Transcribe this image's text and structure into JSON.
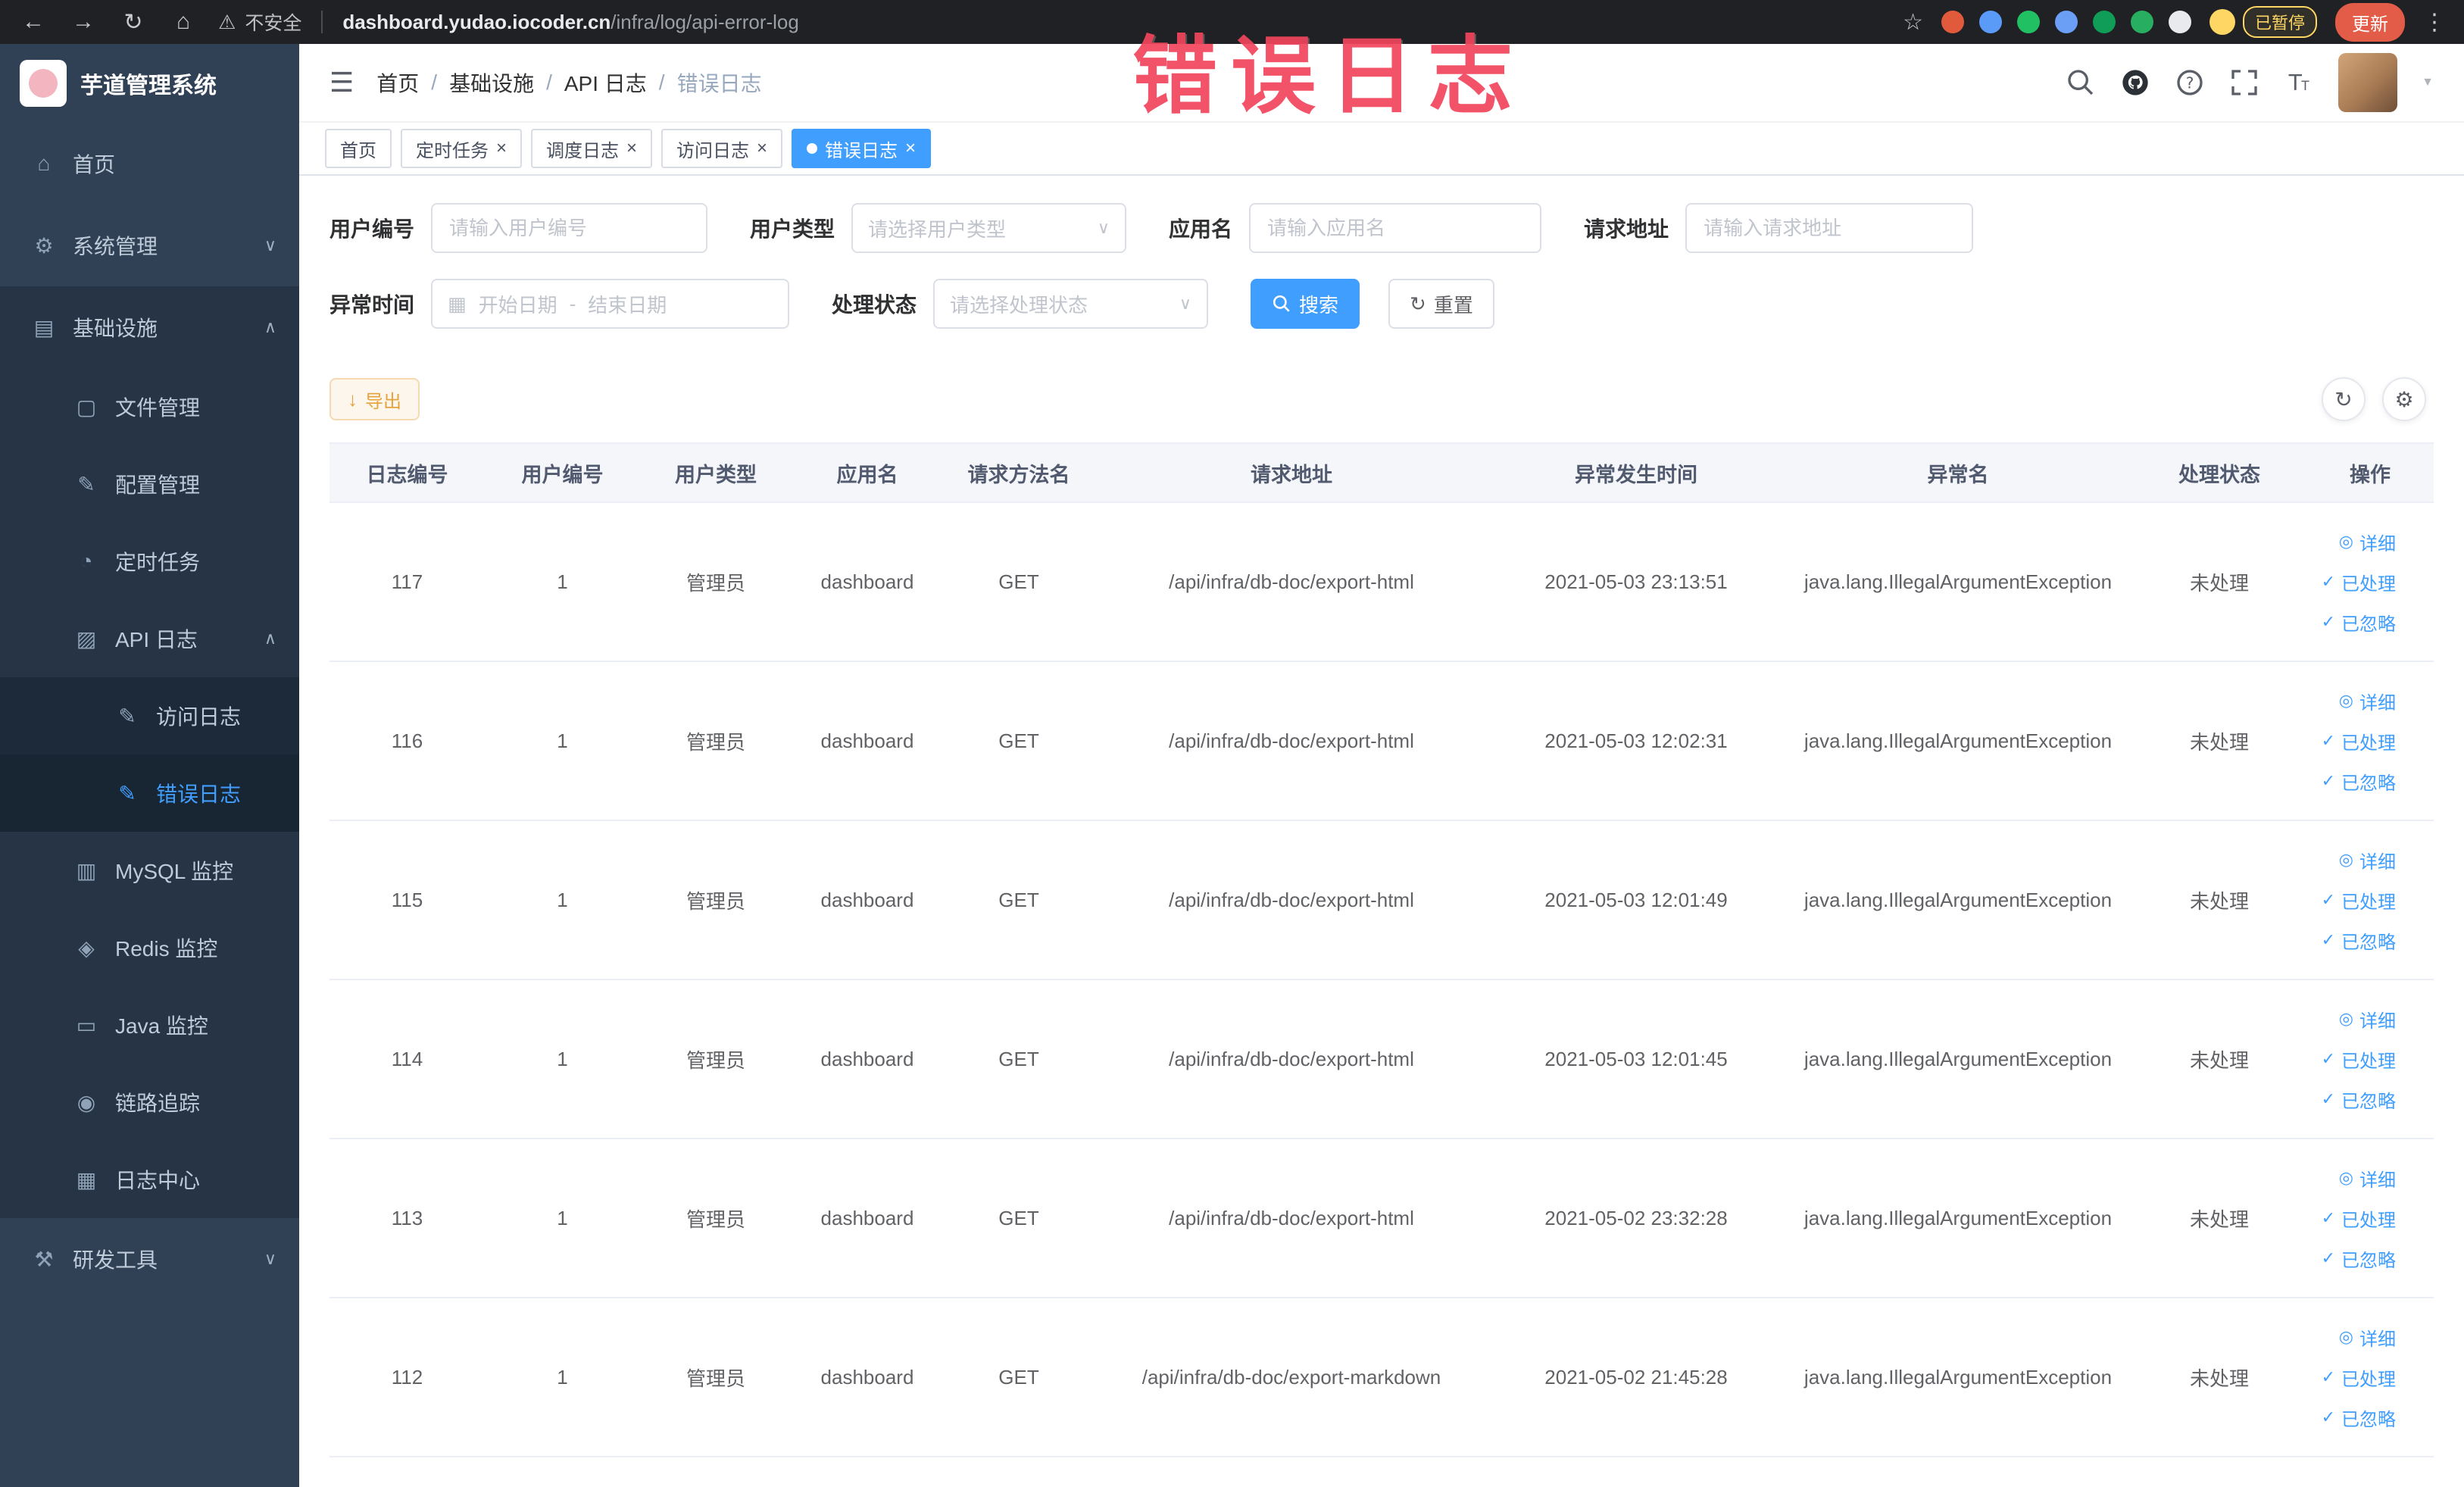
{
  "colors": {
    "primary": "#409eff",
    "warning": "#e6a23c",
    "sidebar_bg": "#304156",
    "chrome_bg": "#202124",
    "annotation_red": "#f2455c"
  },
  "annotation": {
    "text": "错误日志"
  },
  "browser": {
    "security_label": "不安全",
    "url_domain": "dashboard.yudao.iocoder.cn",
    "url_path": "/infra/log/api-error-log",
    "profile_badge": "已暂停",
    "update_label": "更新",
    "extensions": [
      {
        "name": "extension-red-circle-icon",
        "color": "#e25a3c"
      },
      {
        "name": "extension-blue-drop-icon",
        "color": "#5b9bf8"
      },
      {
        "name": "extension-green-circle-icon",
        "color": "#21c063"
      },
      {
        "name": "extension-blue-grid-icon",
        "color": "#6b9ef5"
      },
      {
        "name": "extension-on-badge-icon",
        "color": "#0f9d58"
      },
      {
        "name": "extension-leaf-icon",
        "color": "#27ae60"
      },
      {
        "name": "extension-paw-icon",
        "color": "#e8eaed"
      }
    ]
  },
  "sidebar": {
    "title": "芋道管理系统",
    "items": [
      {
        "id": "home",
        "label": "首页",
        "level": 1,
        "icon": "home-icon"
      },
      {
        "id": "system",
        "label": "系统管理",
        "level": 1,
        "icon": "gear-icon",
        "chevron": "down"
      },
      {
        "id": "infra",
        "label": "基础设施",
        "level": 1,
        "icon": "grid-icon",
        "chevron": "up",
        "open": true
      },
      {
        "id": "file",
        "label": "文件管理",
        "level": 2,
        "icon": "folder-icon"
      },
      {
        "id": "config",
        "label": "配置管理",
        "level": 2,
        "icon": "edit-square-icon"
      },
      {
        "id": "job",
        "label": "定时任务",
        "level": 2,
        "icon": "clock-icon"
      },
      {
        "id": "api-log",
        "label": "API 日志",
        "level": 2,
        "icon": "doc-edit-icon",
        "chevron": "up",
        "open": true
      },
      {
        "id": "access-log",
        "label": "访问日志",
        "level": 3,
        "icon": "edit-square-icon"
      },
      {
        "id": "error-log",
        "label": "错误日志",
        "level": 3,
        "icon": "edit-square-icon",
        "active": true
      },
      {
        "id": "mysql",
        "label": "MySQL 监控",
        "level": 2,
        "icon": "database-icon"
      },
      {
        "id": "redis",
        "label": "Redis 监控",
        "level": 2,
        "icon": "redis-icon"
      },
      {
        "id": "java",
        "label": "Java 监控",
        "level": 2,
        "icon": "monitor-icon"
      },
      {
        "id": "trace",
        "label": "链路追踪",
        "level": 2,
        "icon": "eye-icon"
      },
      {
        "id": "log-center",
        "label": "日志中心",
        "level": 2,
        "icon": "log-center-icon"
      },
      {
        "id": "dev-tools",
        "label": "研发工具",
        "level": 1,
        "icon": "tools-icon",
        "chevron": "down"
      }
    ]
  },
  "header": {
    "breadcrumb": [
      "首页",
      "基础设施",
      "API 日志",
      "错误日志"
    ]
  },
  "tabs": [
    {
      "id": "home",
      "label": "首页",
      "closable": false,
      "active": false
    },
    {
      "id": "job",
      "label": "定时任务",
      "closable": true,
      "active": false
    },
    {
      "id": "job-log",
      "label": "调度日志",
      "closable": true,
      "active": false
    },
    {
      "id": "access-log",
      "label": "访问日志",
      "closable": true,
      "active": false
    },
    {
      "id": "error-log",
      "label": "错误日志",
      "closable": true,
      "active": true
    }
  ],
  "filters": {
    "user_id": {
      "label": "用户编号",
      "placeholder": "请输入用户编号"
    },
    "user_type": {
      "label": "用户类型",
      "placeholder": "请选择用户类型"
    },
    "app_name": {
      "label": "应用名",
      "placeholder": "请输入应用名"
    },
    "request_url": {
      "label": "请求地址",
      "placeholder": "请输入请求地址"
    },
    "exception_time": {
      "label": "异常时间",
      "start_placeholder": "开始日期",
      "separator": "-",
      "end_placeholder": "结束日期"
    },
    "process_status": {
      "label": "处理状态",
      "placeholder": "请选择处理状态"
    },
    "search_label": "搜索",
    "reset_label": "重置"
  },
  "toolbar": {
    "export_label": "导出"
  },
  "table": {
    "columns": [
      {
        "key": "id",
        "label": "日志编号"
      },
      {
        "key": "user_id",
        "label": "用户编号"
      },
      {
        "key": "user_type",
        "label": "用户类型"
      },
      {
        "key": "app",
        "label": "应用名"
      },
      {
        "key": "method",
        "label": "请求方法名"
      },
      {
        "key": "url",
        "label": "请求地址"
      },
      {
        "key": "time",
        "label": "异常发生时间"
      },
      {
        "key": "exception",
        "label": "异常名"
      },
      {
        "key": "status",
        "label": "处理状态"
      },
      {
        "key": "ops",
        "label": "操作"
      }
    ],
    "actions": [
      {
        "id": "detail",
        "label": "详细",
        "icon": "eye-icon"
      },
      {
        "id": "process",
        "label": "已处理",
        "icon": "check-icon"
      },
      {
        "id": "ignore",
        "label": "已忽略",
        "icon": "check-icon"
      }
    ],
    "rows": [
      {
        "id": "117",
        "user_id": "1",
        "user_type": "管理员",
        "app": "dashboard",
        "method": "GET",
        "url": "/api/infra/db-doc/export-html",
        "time": "2021-05-03 23:13:51",
        "exception": "java.lang.IllegalArgumentException",
        "status": "未处理"
      },
      {
        "id": "116",
        "user_id": "1",
        "user_type": "管理员",
        "app": "dashboard",
        "method": "GET",
        "url": "/api/infra/db-doc/export-html",
        "time": "2021-05-03 12:02:31",
        "exception": "java.lang.IllegalArgumentException",
        "status": "未处理"
      },
      {
        "id": "115",
        "user_id": "1",
        "user_type": "管理员",
        "app": "dashboard",
        "method": "GET",
        "url": "/api/infra/db-doc/export-html",
        "time": "2021-05-03 12:01:49",
        "exception": "java.lang.IllegalArgumentException",
        "status": "未处理"
      },
      {
        "id": "114",
        "user_id": "1",
        "user_type": "管理员",
        "app": "dashboard",
        "method": "GET",
        "url": "/api/infra/db-doc/export-html",
        "time": "2021-05-03 12:01:45",
        "exception": "java.lang.IllegalArgumentException",
        "status": "未处理"
      },
      {
        "id": "113",
        "user_id": "1",
        "user_type": "管理员",
        "app": "dashboard",
        "method": "GET",
        "url": "/api/infra/db-doc/export-html",
        "time": "2021-05-02 23:32:28",
        "exception": "java.lang.IllegalArgumentException",
        "status": "未处理"
      },
      {
        "id": "112",
        "user_id": "1",
        "user_type": "管理员",
        "app": "dashboard",
        "method": "GET",
        "url": "/api/infra/db-doc/export-markdown",
        "time": "2021-05-02 21:45:28",
        "exception": "java.lang.IllegalArgumentException",
        "status": "未处理"
      }
    ]
  }
}
